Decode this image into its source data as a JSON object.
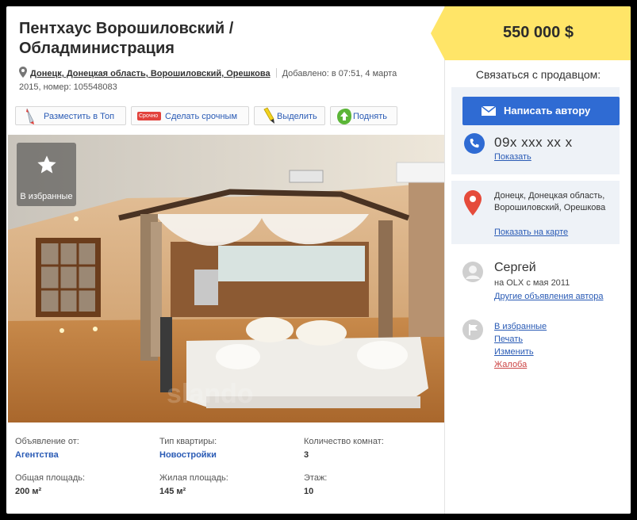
{
  "listing": {
    "title_line1": "Пентхаус Ворошиловский /",
    "title_line2": "Обладминистрация",
    "location": "Донецк, Донецкая область, Ворошиловский, Орешкова",
    "added": "Добавлено: в 07:51, 4 марта",
    "added_cont": "2015, номер: 105548083"
  },
  "actions": [
    {
      "label": "Разместить в Топ",
      "icon": "rocket-icon"
    },
    {
      "label": "Сделать срочным",
      "icon": "urgent-tag-icon",
      "badge": "Срочно"
    },
    {
      "label": "Выделить",
      "icon": "highlighter-icon"
    },
    {
      "label": "Поднять",
      "icon": "raise-up-icon"
    }
  ],
  "photo": {
    "favorite_label": "В избранные",
    "watermark": "slando"
  },
  "params": [
    {
      "key": "Объявление от:",
      "value": "Агентства",
      "link": true
    },
    {
      "key": "Тип квартиры:",
      "value": "Новостройки",
      "link": true
    },
    {
      "key": "Количество комнат:",
      "value": "3",
      "link": false
    },
    {
      "key": "Общая площадь:",
      "value": "200 м²",
      "link": false
    },
    {
      "key": "Жилая площадь:",
      "value": "145 м²",
      "link": false
    },
    {
      "key": "Этаж:",
      "value": "10",
      "link": false
    }
  ],
  "sidebar": {
    "price": "550 000 $",
    "contact_title": "Связаться с продавцом:",
    "write_button": "Написать автору",
    "phone": "09x xxx xx x",
    "show_phone": "Показать",
    "address": "Донецк, Донецкая область, Ворошиловский, Орешкова",
    "show_on_map": "Показать на карте",
    "user_name": "Сергей",
    "user_since": "на OLX с мая 2011",
    "other_ads": "Другие объявления автора",
    "links": {
      "favorites": "В избранные",
      "print": "Печать",
      "edit": "Изменить",
      "complaint": "Жалоба"
    }
  },
  "colors": {
    "accent_blue": "#2f6bd3",
    "link": "#2a5bb5",
    "price_yellow": "#ffe568",
    "panel_bg": "#eef2f7",
    "complaint_red": "#cc4444"
  }
}
